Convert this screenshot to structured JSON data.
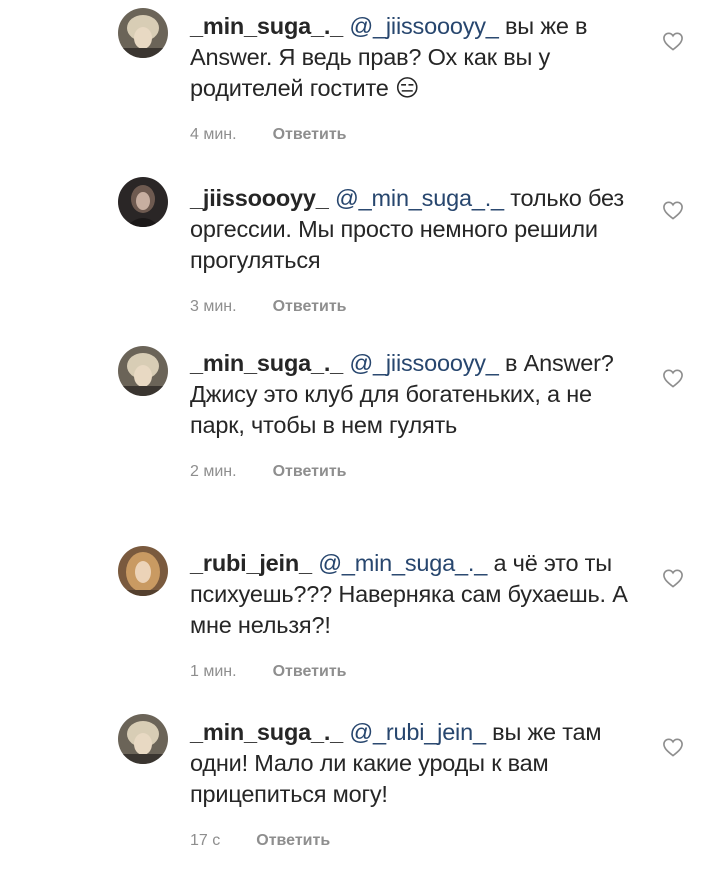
{
  "comments": [
    {
      "username": "_min_suga_._",
      "mention": "@_jiissoooyy_",
      "text": "вы же в Answer. Я ведь прав? Ох как вы у родителей гостите 😑",
      "time": "4 мин.",
      "reply": "Ответить",
      "avatar": "avatar-suga"
    },
    {
      "username": "_jiissoooyy_",
      "mention": "@_min_suga_._",
      "text": "только без оргессии. Мы просто немного решили прогуляться",
      "time": "3 мин.",
      "reply": "Ответить",
      "avatar": "avatar-jisoo"
    },
    {
      "username": "_min_suga_._",
      "mention": "@_jiissoooyy_",
      "text": "в Answer? Джису это клуб для богатеньких, а не парк, чтобы в нем гулять",
      "time": "2 мин.",
      "reply": "Ответить",
      "avatar": "avatar-suga"
    },
    {
      "username": "_rubi_jein_",
      "mention": "@_min_suga_._",
      "text": "а чё это ты психуешь??? Наверняка сам бухаешь. А мне нельзя?!",
      "time": "1 мин.",
      "reply": "Ответить",
      "avatar": "avatar-rubi"
    },
    {
      "username": "_min_suga_._",
      "mention": "@_rubi_jein_",
      "text": "вы же там одни! Мало ли какие уроды к вам прицепиться могу!",
      "time": "17 с",
      "reply": "Ответить",
      "avatar": "avatar-suga"
    }
  ],
  "colors": {
    "text": "#262626",
    "muted": "#8e8e8e",
    "mention": "#27466e",
    "background": "#ffffff"
  },
  "icons": {
    "like": "heart-outline-icon"
  }
}
